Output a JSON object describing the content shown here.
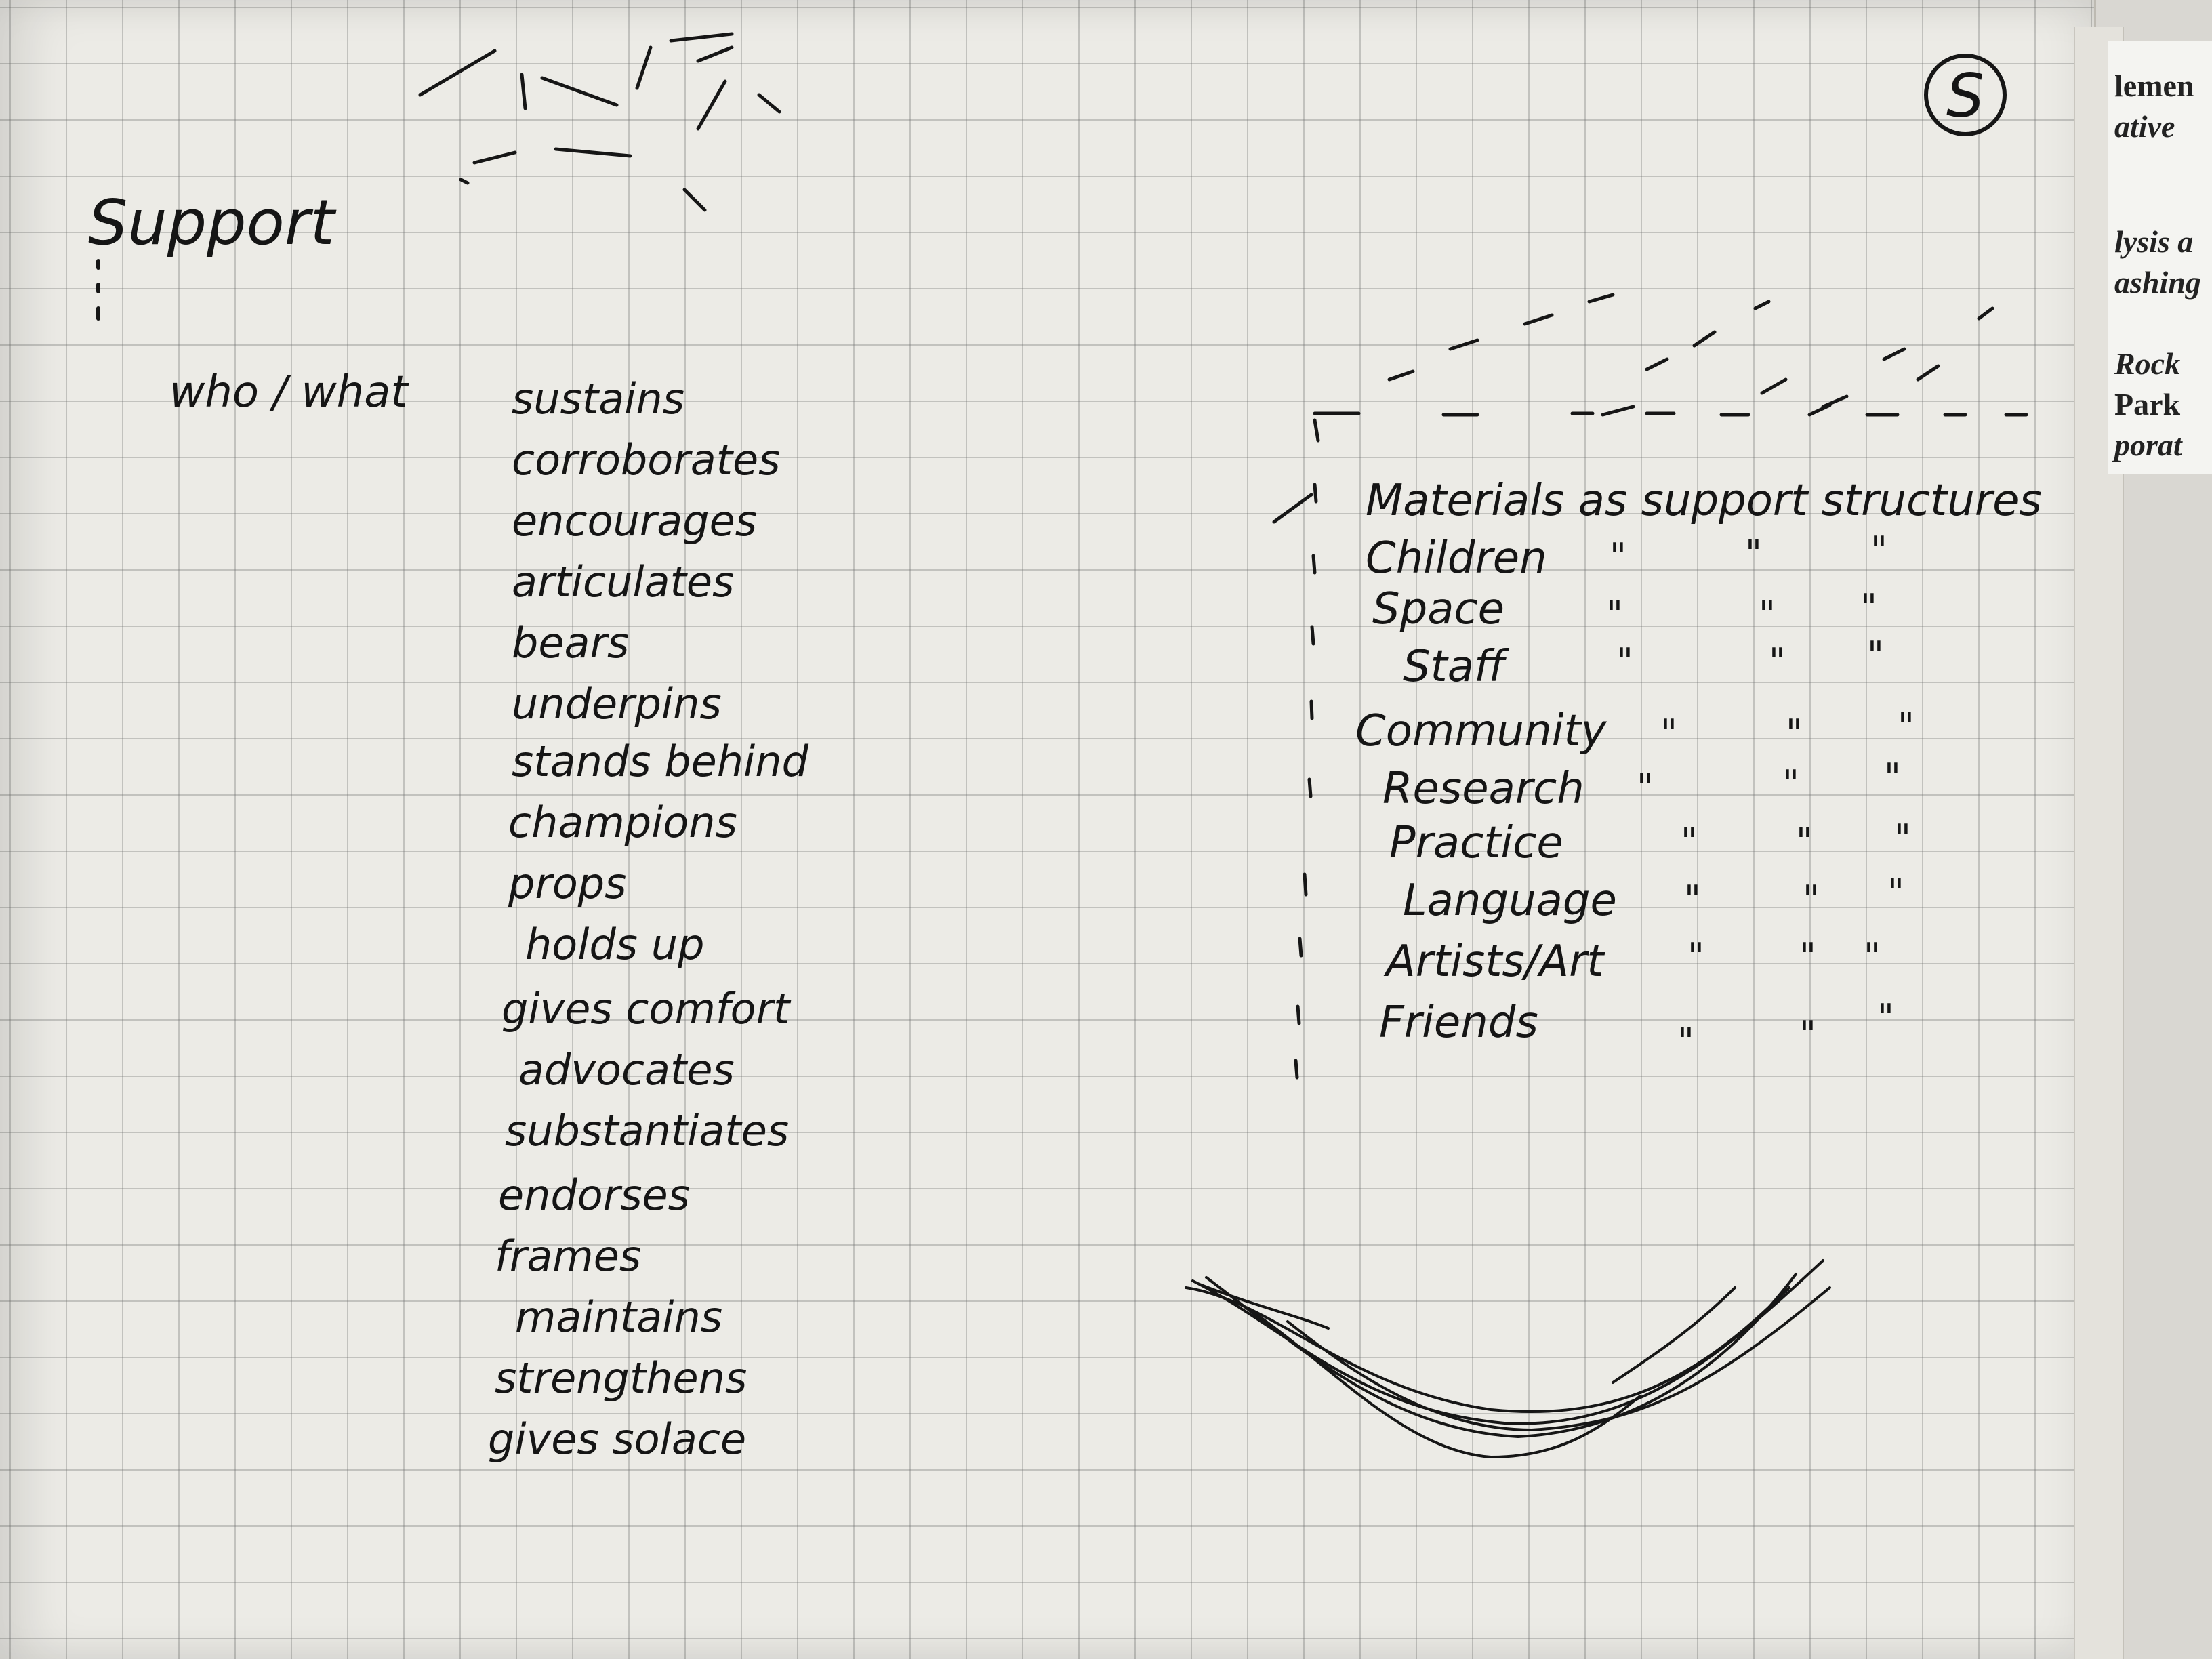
{
  "page_heading": "Support",
  "subject_label": "who / what",
  "verbs": [
    "sustains",
    "corroborates",
    "encourages",
    "articulates",
    "bears",
    "underpins",
    "stands behind",
    "champions",
    "props",
    "holds up",
    "gives comfort",
    "advocates",
    "substantiates",
    "endorses",
    "frames",
    "maintains",
    "strengthens",
    "gives solace"
  ],
  "structures_header": "Materials as support structures",
  "structures_items": [
    "Children",
    "Space",
    "Staff",
    "Community",
    "Research",
    "Practice",
    "Language",
    "Artists/Art",
    "Friends"
  ],
  "ditto_mark": "\"",
  "corner_mark": "S",
  "background_doc_lines": [
    "lemen",
    "ative",
    "lysis a",
    "ashing",
    "Rock",
    "Park",
    "porat"
  ]
}
